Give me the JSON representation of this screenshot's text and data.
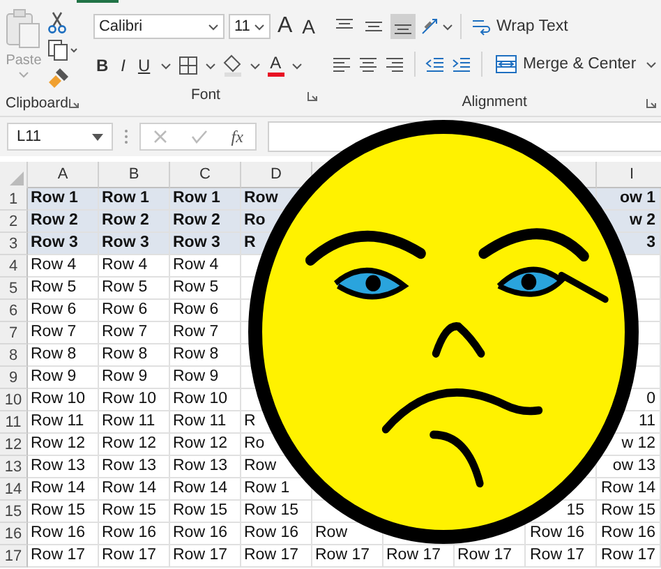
{
  "clipboard": {
    "paste": "Paste",
    "group_label": "Clipboard"
  },
  "font": {
    "font_name": "Calibri",
    "font_size": "11",
    "grow": "A",
    "shrink": "A",
    "bold": "B",
    "italic": "I",
    "underline": "U",
    "font_color": "A",
    "group_label": "Font"
  },
  "alignment": {
    "vertical_align": [
      {
        "selected": false
      },
      {
        "selected": false
      },
      {
        "selected": true
      }
    ],
    "wrap_text": "Wrap Text",
    "merge_center": "Merge & Center",
    "group_label": "Alignment"
  },
  "formula_bar": {
    "name_box": "L11",
    "fx": "fx"
  },
  "sheet": {
    "columns": [
      "A",
      "B",
      "C",
      "D",
      null,
      null,
      null,
      null,
      "I"
    ],
    "rows": [
      {
        "number": "1",
        "highlighted": true,
        "cells": [
          "Row 1",
          "Row 1",
          "Row 1",
          "Row",
          null,
          null,
          null,
          null,
          "ow 1"
        ]
      },
      {
        "number": "2",
        "highlighted": true,
        "cells": [
          "Row 2",
          "Row 2",
          "Row 2",
          "Ro",
          null,
          null,
          null,
          null,
          "w 2"
        ]
      },
      {
        "number": "3",
        "highlighted": true,
        "cells": [
          "Row 3",
          "Row 3",
          "Row 3",
          "R",
          null,
          null,
          null,
          null,
          "3"
        ]
      },
      {
        "number": "4",
        "highlighted": false,
        "cells": [
          "Row 4",
          "Row 4",
          "Row 4",
          null,
          null,
          null,
          null,
          null,
          null
        ]
      },
      {
        "number": "5",
        "highlighted": false,
        "cells": [
          "Row 5",
          "Row 5",
          "Row 5",
          null,
          null,
          null,
          null,
          null,
          null
        ]
      },
      {
        "number": "6",
        "highlighted": false,
        "cells": [
          "Row 6",
          "Row 6",
          "Row 6",
          null,
          null,
          null,
          null,
          null,
          null
        ]
      },
      {
        "number": "7",
        "highlighted": false,
        "cells": [
          "Row 7",
          "Row 7",
          "Row 7",
          null,
          null,
          null,
          null,
          null,
          null
        ]
      },
      {
        "number": "8",
        "highlighted": false,
        "cells": [
          "Row 8",
          "Row 8",
          "Row 8",
          null,
          null,
          null,
          null,
          null,
          null
        ]
      },
      {
        "number": "9",
        "highlighted": false,
        "cells": [
          "Row 9",
          "Row 9",
          "Row 9",
          null,
          null,
          null,
          null,
          null,
          null
        ]
      },
      {
        "number": "10",
        "highlighted": false,
        "cells": [
          "Row 10",
          "Row 10",
          "Row 10",
          null,
          null,
          null,
          null,
          null,
          "0"
        ]
      },
      {
        "number": "11",
        "highlighted": false,
        "cells": [
          "Row 11",
          "Row 11",
          "Row 11",
          "R",
          null,
          null,
          null,
          null,
          "11"
        ]
      },
      {
        "number": "12",
        "highlighted": false,
        "cells": [
          "Row 12",
          "Row 12",
          "Row 12",
          "Ro",
          null,
          null,
          null,
          null,
          "w 12"
        ]
      },
      {
        "number": "13",
        "highlighted": false,
        "cells": [
          "Row 13",
          "Row 13",
          "Row 13",
          "Row",
          null,
          null,
          null,
          null,
          "ow 13"
        ]
      },
      {
        "number": "14",
        "highlighted": false,
        "cells": [
          "Row 14",
          "Row 14",
          "Row 14",
          "Row 1",
          null,
          null,
          null,
          null,
          "Row 14"
        ]
      },
      {
        "number": "15",
        "highlighted": false,
        "cells": [
          "Row 15",
          "Row 15",
          "Row 15",
          "Row 15",
          null,
          null,
          null,
          "15",
          "Row 15"
        ]
      },
      {
        "number": "16",
        "highlighted": false,
        "cells": [
          "Row 16",
          "Row 16",
          "Row 16",
          "Row 16",
          "Row",
          null,
          null,
          "Row 16",
          "Row 16"
        ]
      },
      {
        "number": "17",
        "highlighted": false,
        "cells": [
          "Row 17",
          "Row 17",
          "Row 17",
          "Row 17",
          "Row 17",
          "Row 17",
          "Row 17",
          "Row 17",
          "Row 17"
        ]
      }
    ]
  }
}
